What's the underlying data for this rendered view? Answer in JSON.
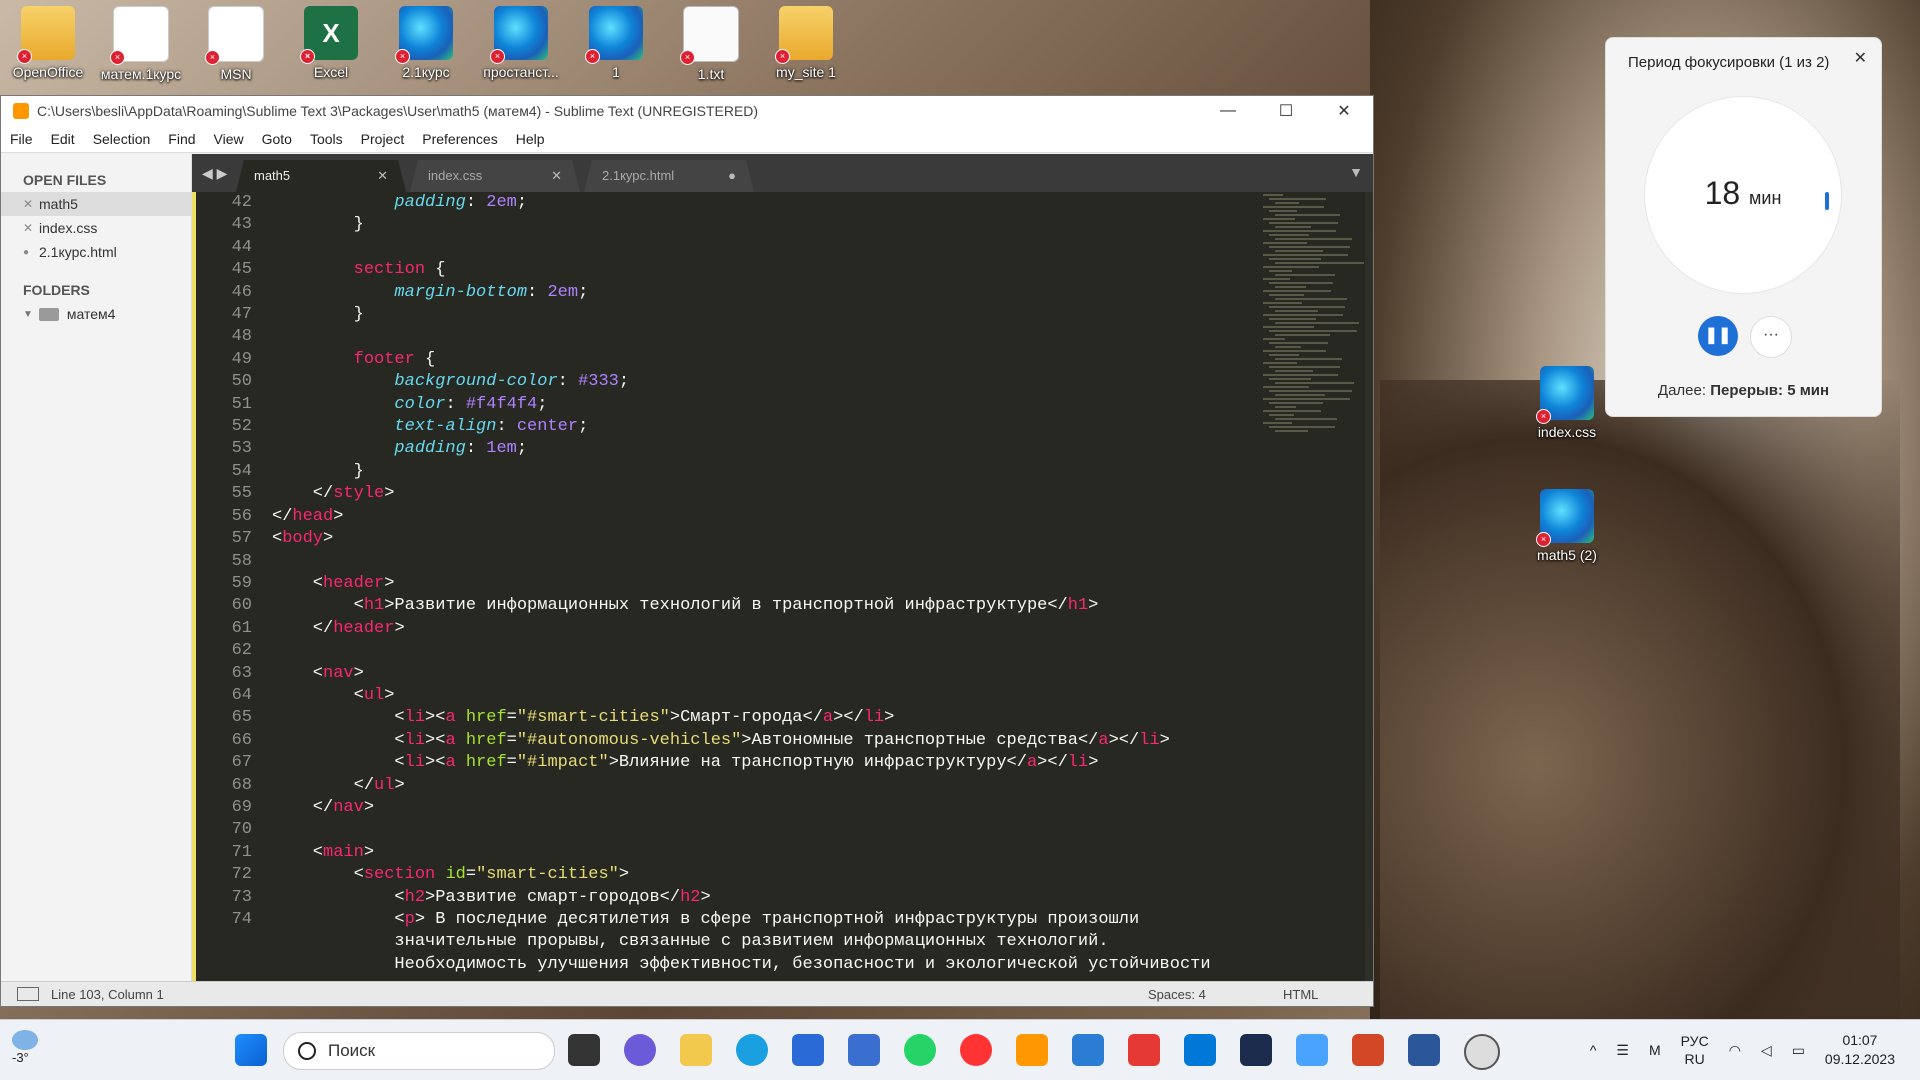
{
  "desktop_icons": [
    {
      "label": "OpenOffice",
      "icon": "folder-icon"
    },
    {
      "label": "матем.1курс",
      "icon": "document-icon"
    },
    {
      "label": "MSN",
      "icon": "document-icon"
    },
    {
      "label": "Excel",
      "icon": "excel-icon"
    },
    {
      "label": "2.1курс",
      "icon": "edge-icon"
    },
    {
      "label": "простанст...",
      "icon": "edge-icon"
    },
    {
      "label": "1",
      "icon": "edge-icon"
    },
    {
      "label": "1.txt",
      "icon": "text-file-icon"
    },
    {
      "label": "my_site 1",
      "icon": "folder-icon"
    },
    {
      "label": "index.css",
      "icon": "edge-icon"
    },
    {
      "label": "math5 (2)",
      "icon": "edge-icon"
    }
  ],
  "window": {
    "title": "C:\\Users\\besli\\AppData\\Roaming\\Sublime Text 3\\Packages\\User\\math5 (матем4) - Sublime Text (UNREGISTERED)",
    "minimize": "—",
    "maximize": "☐",
    "close": "✕"
  },
  "menu": [
    "File",
    "Edit",
    "Selection",
    "Find",
    "View",
    "Goto",
    "Tools",
    "Project",
    "Preferences",
    "Help"
  ],
  "sidebar": {
    "open_files_header": "OPEN FILES",
    "open_files": [
      {
        "name": "math5",
        "marker": "✕"
      },
      {
        "name": "index.css",
        "marker": "✕"
      },
      {
        "name": "2.1курс.html",
        "marker": "●"
      }
    ],
    "folders_header": "FOLDERS",
    "folder": "матем4"
  },
  "tabs": [
    {
      "label": "math5",
      "close": "✕"
    },
    {
      "label": "index.css",
      "close": "✕"
    },
    {
      "label": "2.1курс.html",
      "close": "●"
    }
  ],
  "tab_nav": "◀ ▶",
  "code_lines": [
    {
      "n": "42",
      "html": "            <span class=\"prop\">padding</span>: <span class=\"num\">2em</span>;"
    },
    {
      "n": "43",
      "html": "        }"
    },
    {
      "n": "44",
      "html": ""
    },
    {
      "n": "45",
      "html": "        <span class=\"sel-k\">section</span> {"
    },
    {
      "n": "46",
      "html": "            <span class=\"prop\">margin-bottom</span>: <span class=\"num\">2em</span>;"
    },
    {
      "n": "47",
      "html": "        }"
    },
    {
      "n": "48",
      "html": ""
    },
    {
      "n": "49",
      "html": "        <span class=\"sel-k\">footer</span> {"
    },
    {
      "n": "50",
      "html": "            <span class=\"prop\">background-color</span>: <span class=\"num\">#333</span>;"
    },
    {
      "n": "51",
      "html": "            <span class=\"prop\">color</span>: <span class=\"num\">#f4f4f4</span>;"
    },
    {
      "n": "52",
      "html": "            <span class=\"prop\">text-align</span>: <span class=\"num\">center</span>;"
    },
    {
      "n": "53",
      "html": "            <span class=\"prop\">padding</span>: <span class=\"num\">1em</span>;"
    },
    {
      "n": "54",
      "html": "        }"
    },
    {
      "n": "55",
      "html": "    &lt;/<span class=\"tag\">style</span>&gt;"
    },
    {
      "n": "56",
      "html": "&lt;/<span class=\"tag\">head</span>&gt;"
    },
    {
      "n": "57",
      "html": "&lt;<span class=\"tag\">body</span>&gt;"
    },
    {
      "n": "58",
      "html": ""
    },
    {
      "n": "59",
      "html": "    &lt;<span class=\"tag\">header</span>&gt;"
    },
    {
      "n": "60",
      "html": "        &lt;<span class=\"tag\">h1</span>&gt;Развитие информационных технологий в транспортной инфраструктуре&lt;/<span class=\"tag\">h1</span>&gt;"
    },
    {
      "n": "61",
      "html": "    &lt;/<span class=\"tag\">header</span>&gt;"
    },
    {
      "n": "62",
      "html": ""
    },
    {
      "n": "63",
      "html": "    &lt;<span class=\"tag\">nav</span>&gt;"
    },
    {
      "n": "64",
      "html": "        &lt;<span class=\"tag\">ul</span>&gt;"
    },
    {
      "n": "65",
      "html": "            &lt;<span class=\"tag\">li</span>&gt;&lt;<span class=\"tag\">a</span> <span class=\"attr\">href</span>=<span class=\"str\">\"#smart-cities\"</span>&gt;Смарт-города&lt;/<span class=\"tag\">a</span>&gt;&lt;/<span class=\"tag\">li</span>&gt;"
    },
    {
      "n": "66",
      "html": "            &lt;<span class=\"tag\">li</span>&gt;&lt;<span class=\"tag\">a</span> <span class=\"attr\">href</span>=<span class=\"str\">\"#autonomous-vehicles\"</span>&gt;Автономные транспортные средства&lt;/<span class=\"tag\">a</span>&gt;&lt;/<span class=\"tag\">li</span>&gt;"
    },
    {
      "n": "67",
      "html": "            &lt;<span class=\"tag\">li</span>&gt;&lt;<span class=\"tag\">a</span> <span class=\"attr\">href</span>=<span class=\"str\">\"#impact\"</span>&gt;Влияние на транспортную инфраструктуру&lt;/<span class=\"tag\">a</span>&gt;&lt;/<span class=\"tag\">li</span>&gt;"
    },
    {
      "n": "68",
      "html": "        &lt;/<span class=\"tag\">ul</span>&gt;"
    },
    {
      "n": "69",
      "html": "    &lt;/<span class=\"tag\">nav</span>&gt;"
    },
    {
      "n": "70",
      "html": ""
    },
    {
      "n": "71",
      "html": "    &lt;<span class=\"tag\">main</span>&gt;"
    },
    {
      "n": "72",
      "html": "        &lt;<span class=\"tag\">section</span> <span class=\"attr\">id</span>=<span class=\"str\">\"smart-cities\"</span>&gt;"
    },
    {
      "n": "73",
      "html": "            &lt;<span class=\"tag\">h2</span>&gt;Развитие смарт-городов&lt;/<span class=\"tag\">h2</span>&gt;"
    },
    {
      "n": "74",
      "html": "            &lt;<span class=\"tag\">p</span>&gt; В последние десятилетия в сфере транспортной инфраструктуры произошли"
    },
    {
      "n": "",
      "html": "            значительные прорывы, связанные с развитием информационных технологий."
    },
    {
      "n": "",
      "html": "            Необходимость улучшения эффективности, безопасности и экологической устойчивости"
    }
  ],
  "status": {
    "position": "Line 103, Column 1",
    "spaces": "Spaces: 4",
    "syntax": "HTML"
  },
  "focus": {
    "title": "Период фокусировки (1 из 2)",
    "minutes": "18",
    "unit": "мин",
    "pause": "❚❚",
    "more": "···",
    "next_prefix": "Далее:",
    "next_value": "Перерыв: 5 мин"
  },
  "taskbar": {
    "weather": "-3°",
    "search_placeholder": "Поиск",
    "lang_top": "РУС",
    "lang_bottom": "RU",
    "time": "01:07",
    "date": "09.12.2023",
    "chevron": "^"
  }
}
